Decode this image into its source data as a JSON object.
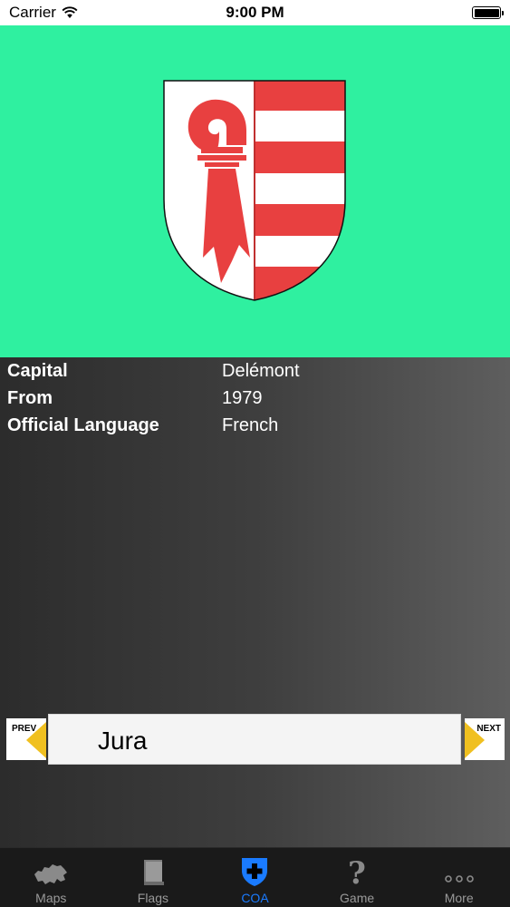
{
  "status_bar": {
    "carrier": "Carrier",
    "time": "9:00 PM"
  },
  "coat_of_arms": {
    "canton": "Jura",
    "background_color": "#2ff0a0",
    "colors": {
      "red": "#e84040",
      "white": "#ffffff"
    }
  },
  "info": {
    "rows": [
      {
        "label": "Capital",
        "value": "Delémont"
      },
      {
        "label": "From",
        "value": "1979"
      },
      {
        "label": "Official Language",
        "value": "French"
      }
    ]
  },
  "navigator": {
    "prev_label": "PREV",
    "next_label": "NEXT",
    "current": "Jura"
  },
  "tabs": [
    {
      "label": "Maps",
      "icon": "switzerland-map-icon",
      "active": false
    },
    {
      "label": "Flags",
      "icon": "flag-book-icon",
      "active": false
    },
    {
      "label": "COA",
      "icon": "swiss-shield-icon",
      "active": true
    },
    {
      "label": "Game",
      "icon": "question-mark-icon",
      "active": false
    },
    {
      "label": "More",
      "icon": "more-dots-icon",
      "active": false
    }
  ],
  "colors": {
    "accent": "#1a7bff",
    "tab_inactive": "#999999",
    "tab_bar_bg": "#1a1a1a"
  }
}
